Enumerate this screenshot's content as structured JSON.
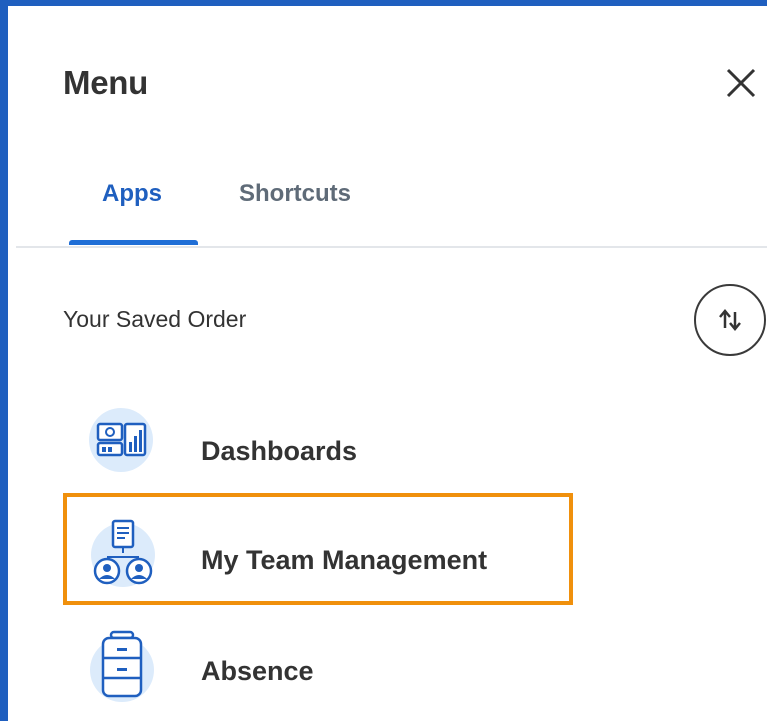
{
  "menu": {
    "title": "Menu",
    "close_icon": "close-icon"
  },
  "tabs": [
    {
      "label": "Apps",
      "active": true
    },
    {
      "label": "Shortcuts",
      "active": false
    }
  ],
  "saved_order": {
    "label": "Your Saved Order",
    "sort_icon": "sort-arrows-icon"
  },
  "apps": [
    {
      "label": "Dashboards",
      "icon": "dashboards-icon",
      "selected": false
    },
    {
      "label": "My Team Management",
      "icon": "team-management-icon",
      "selected": true
    },
    {
      "label": "Absence",
      "icon": "absence-icon",
      "selected": false
    }
  ],
  "colors": {
    "accent": "#1f5fbf",
    "highlight": "#f0900c",
    "text": "#333333"
  }
}
